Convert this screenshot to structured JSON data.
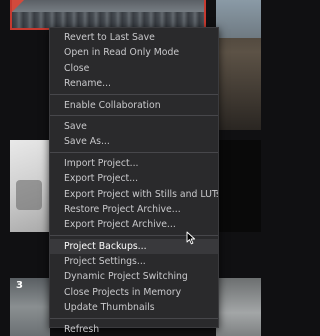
{
  "background": {
    "bottom_thumbnail_number": "3"
  },
  "menu": {
    "groups": [
      [
        "Revert to Last Save",
        "Open in Read Only Mode",
        "Close",
        "Rename..."
      ],
      [
        "Enable Collaboration"
      ],
      [
        "Save",
        "Save As..."
      ],
      [
        "Import Project...",
        "Export Project...",
        "Export Project with Stills and LUTs...",
        "Restore Project Archive...",
        "Export Project Archive..."
      ],
      [
        "Project Backups...",
        "Project Settings...",
        "Dynamic Project Switching",
        "Close Projects in Memory",
        "Update Thumbnails"
      ],
      [
        "Refresh"
      ]
    ],
    "hovered_item": "Project Backups..."
  },
  "colors": {
    "menu_bg": "#2a2a2c",
    "menu_text": "#c9c9cc",
    "hover_bg": "#39393c",
    "selection_border": "#c63a30"
  },
  "icons": {
    "cursor": "mouse-pointer-icon"
  }
}
